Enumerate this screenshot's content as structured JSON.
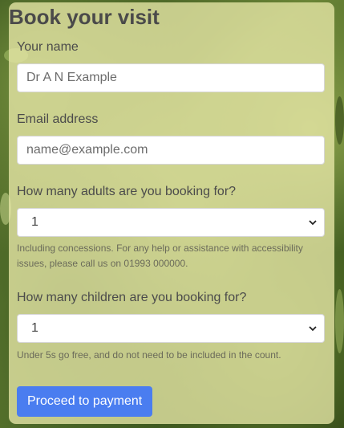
{
  "form": {
    "title": "Book your visit",
    "name": {
      "label": "Your name",
      "placeholder": "Dr A N Example"
    },
    "email": {
      "label": "Email address",
      "placeholder": "name@example.com"
    },
    "adults": {
      "label": "How many adults are you booking for?",
      "value": "1",
      "help": "Including concessions. For any help or assistance with accessibility issues, please call us on 01993 000000."
    },
    "children": {
      "label": "How many children are you booking for?",
      "value": "1",
      "help": "Under 5s go free, and do not need to be included in the count."
    },
    "submit_label": "Proceed to payment"
  },
  "colors": {
    "card": "#e8e8a8",
    "button": "#4a7df0",
    "text": "#4b4b4b"
  },
  "icons": {
    "select": "chevron-down-icon"
  }
}
